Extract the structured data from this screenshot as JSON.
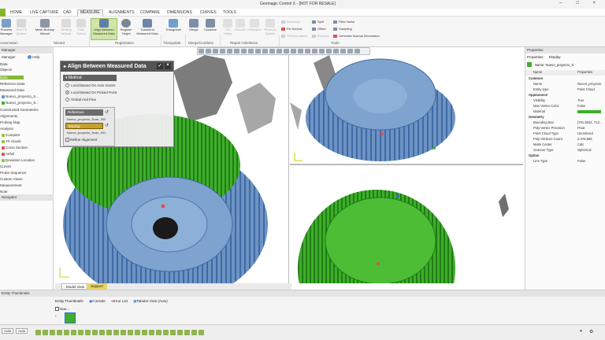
{
  "window": {
    "title": "Geomagic Control X - [NOT FOR RESALE]",
    "controls": [
      "–",
      "□",
      "×"
    ]
  },
  "menu": {
    "tabs": [
      "HOME",
      "LIVE CAPTURE",
      "CAD",
      "MEASURE",
      "ALIGNMENTS",
      "COMPARE",
      "DIMENSIONS",
      "CURVES",
      "TOOLS"
    ],
    "active": "MEASURE"
  },
  "ribbon": {
    "buttons": [
      {
        "label": "Process Manager",
        "icon": "process-manager-icon",
        "dim": false
      },
      {
        "label": "Best Fit Sphere",
        "icon": "sphere-icon",
        "dim": true
      },
      {
        "label": "Mesh Buildup Wizard",
        "icon": "mesh-wizard-icon",
        "dim": false
      },
      {
        "label": "Healing Wizard",
        "icon": "healing-icon",
        "dim": true
      },
      {
        "label": "Hole Option",
        "icon": "hole-icon",
        "dim": true
      },
      {
        "label": "Align Between Measured Data",
        "icon": "align-icon",
        "dim": false,
        "selected": true
      },
      {
        "label": "Register Target",
        "icon": "register-target-icon",
        "dim": false
      },
      {
        "label": "Transform Measured Data",
        "icon": "transform-icon",
        "dim": false
      },
      {
        "label": "Triangulate",
        "icon": "triangulate-icon",
        "dim": false
      },
      {
        "label": "Merge",
        "icon": "merge-icon",
        "dim": false
      },
      {
        "label": "Combine",
        "icon": "combine-icon",
        "dim": false
      },
      {
        "label": "Fill Holes",
        "icon": "fill-holes-icon",
        "dim": true
      },
      {
        "label": "Smooth",
        "icon": "smooth-icon",
        "dim": true
      },
      {
        "label": "Defeature",
        "icon": "defeature-icon",
        "dim": true
      },
      {
        "label": "Remove Spikes",
        "icon": "remove-spikes-icon",
        "dim": true
      }
    ],
    "small_items": [
      {
        "label": "Decimate",
        "dim": true
      },
      {
        "label": "Fix Normal",
        "dim": false
      },
      {
        "label": "Fill Boundaries",
        "dim": true
      },
      {
        "label": "Split",
        "dim": false
      },
      {
        "label": "Offset",
        "dim": false
      },
      {
        "label": "Reverse",
        "dim": true
      },
      {
        "label": "Filter Noise",
        "dim": false
      },
      {
        "label": "Sampling",
        "dim": false
      },
      {
        "label": "Generate Normal Information",
        "dim": false
      }
    ],
    "groups": [
      "Automation",
      "Wizard",
      "Registration",
      "Triangulate",
      "Merge/Combine",
      "Repair Hole/Boss",
      "Tools"
    ]
  },
  "left_panel": {
    "header": "Manager",
    "manager_tab": "Manager",
    "help_tab": "Help",
    "sections": [
      "Data",
      "Objects"
    ],
    "tree": [
      "Data",
      "Reference Data",
      "Measured Data",
      "Nuevo_proyecto_S...",
      "Nuevo_proyecto_S...",
      "Constructed Geometries",
      "Alignments",
      "Probing Map",
      "Analysis",
      "Compare",
      "Yh clouds",
      "Cross Section",
      "Airfoil",
      "Deviation Location",
      "Curves",
      "Probe Sequence",
      "Custom Views",
      "Measurement",
      "Note"
    ],
    "navigator_label": "Navigator"
  },
  "align_panel": {
    "title": "Align Between Measured Data",
    "method_header": "Method",
    "methods": [
      {
        "label": "Local Based On Auto Guess",
        "checked": false
      },
      {
        "label": "Local Based On Picked Point",
        "checked": true
      },
      {
        "label": "Global And Fine",
        "checked": false
      }
    ],
    "reference_label": "Reference",
    "reference_value": "Nuevo_proyecto_Scan_000",
    "moving_label": "Moving",
    "moving_value": "Nuevo_proyecto_Scan_001",
    "refine_label": "Refine Alignment",
    "refine_checked": true
  },
  "view_tabs": [
    "Model View",
    "Support"
  ],
  "properties": {
    "header": "Properties",
    "tabs": [
      "Properties",
      "Display"
    ],
    "name_line": "Name: Nuevo_proyecto_S",
    "columns": [
      "Name",
      "Properties"
    ],
    "rows": [
      {
        "type": "cat",
        "key": "Common",
        "value": ""
      },
      {
        "type": "row",
        "key": "Name",
        "value": "Nuevo_proyecto"
      },
      {
        "type": "row",
        "key": "Entity type",
        "value": "Point Cloud"
      },
      {
        "type": "cat",
        "key": "Appearance",
        "value": ""
      },
      {
        "type": "row",
        "key": "Visibility",
        "value": "True"
      },
      {
        "type": "row",
        "key": "Max Vertex Color",
        "value": "False"
      },
      {
        "type": "row",
        "key": "Material",
        "value": ""
      },
      {
        "type": "cat",
        "key": "Geometry",
        "value": ""
      },
      {
        "type": "row",
        "key": "Bounding Box",
        "value": "[781.5042, 712..."
      },
      {
        "type": "row",
        "key": "Poly-Vertex Precision",
        "value": "Float"
      },
      {
        "type": "row",
        "key": "Point Cloud Type",
        "value": "Unordered"
      },
      {
        "type": "row",
        "key": "Poly-Vertices Count",
        "value": "2,476,586"
      },
      {
        "type": "row",
        "key": "Mass Center",
        "value": "Calc"
      },
      {
        "type": "row",
        "key": "Scanner Type",
        "value": "Spherical"
      },
      {
        "type": "cat",
        "key": "Option",
        "value": ""
      },
      {
        "type": "row",
        "key": "Line Type",
        "value": "False"
      }
    ]
  },
  "bottom": {
    "header": "Entity Thumbnails",
    "tabs": [
      "Entity Thumbnails",
      "Console",
      "Error List",
      "Tabular View (Auto)"
    ],
    "item_label": "Nue...",
    "auto_labels": [
      "Auto",
      "Auto"
    ]
  },
  "colors": {
    "accent": "#8dc63f",
    "scan_blue": "#6d93c4",
    "scan_green": "#3fae2a",
    "panel_dark": "#555555"
  }
}
